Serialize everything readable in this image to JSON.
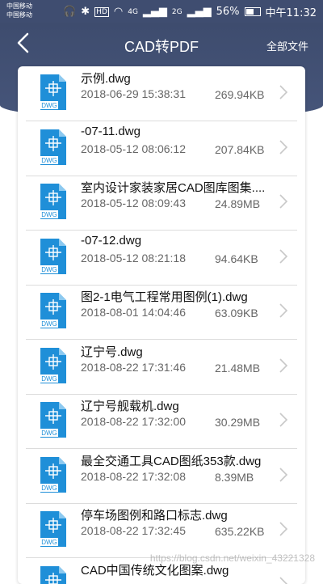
{
  "status_bar": {
    "carrier1": "中国移动",
    "carrier2": "中国移动",
    "signal1": "4G",
    "signal2": "2G",
    "battery": "56%",
    "time": "中午11:32"
  },
  "header": {
    "title": "CAD转PDF",
    "all_files": "全部文件"
  },
  "files": [
    {
      "name": "示例.dwg",
      "date": "2018-06-29 15:38:31",
      "size": "269.94KB",
      "icon_label": "DWG"
    },
    {
      "name": "-07-11.dwg",
      "date": "2018-05-12 08:06:12",
      "size": "207.84KB",
      "icon_label": "DWG"
    },
    {
      "name": "室内设计家装家居CAD图库图集....",
      "date": "2018-05-12 08:09:43",
      "size": "24.89MB",
      "icon_label": "DWG"
    },
    {
      "name": "-07-12.dwg",
      "date": "2018-05-12 08:21:18",
      "size": "94.64KB",
      "icon_label": "DWG"
    },
    {
      "name": "图2-1电气工程常用图例(1).dwg",
      "date": "2018-08-01 14:04:46",
      "size": "63.09KB",
      "icon_label": "DWG"
    },
    {
      "name": "辽宁号.dwg",
      "date": "2018-08-22 17:31:46",
      "size": "21.48MB",
      "icon_label": "DWG"
    },
    {
      "name": "辽宁号舰载机.dwg",
      "date": "2018-08-22 17:32:00",
      "size": "30.29MB",
      "icon_label": "DWG"
    },
    {
      "name": "最全交通工具CAD图纸353款.dwg",
      "date": "2018-08-22 17:32:08",
      "size": "8.39MB",
      "icon_label": "DWG"
    },
    {
      "name": "停车场图例和路口标志.dwg",
      "date": "2018-08-22 17:32:45",
      "size": "635.22KB",
      "icon_label": "DWG"
    },
    {
      "name": "CAD中国传统文化图案.dwg",
      "date": "",
      "size": "",
      "icon_label": "DWG"
    }
  ],
  "watermark": "https://blog.csdn.net/weixin_43221328",
  "colors": {
    "header": "#3f4d70",
    "icon_blue": "#1f8fd8"
  }
}
